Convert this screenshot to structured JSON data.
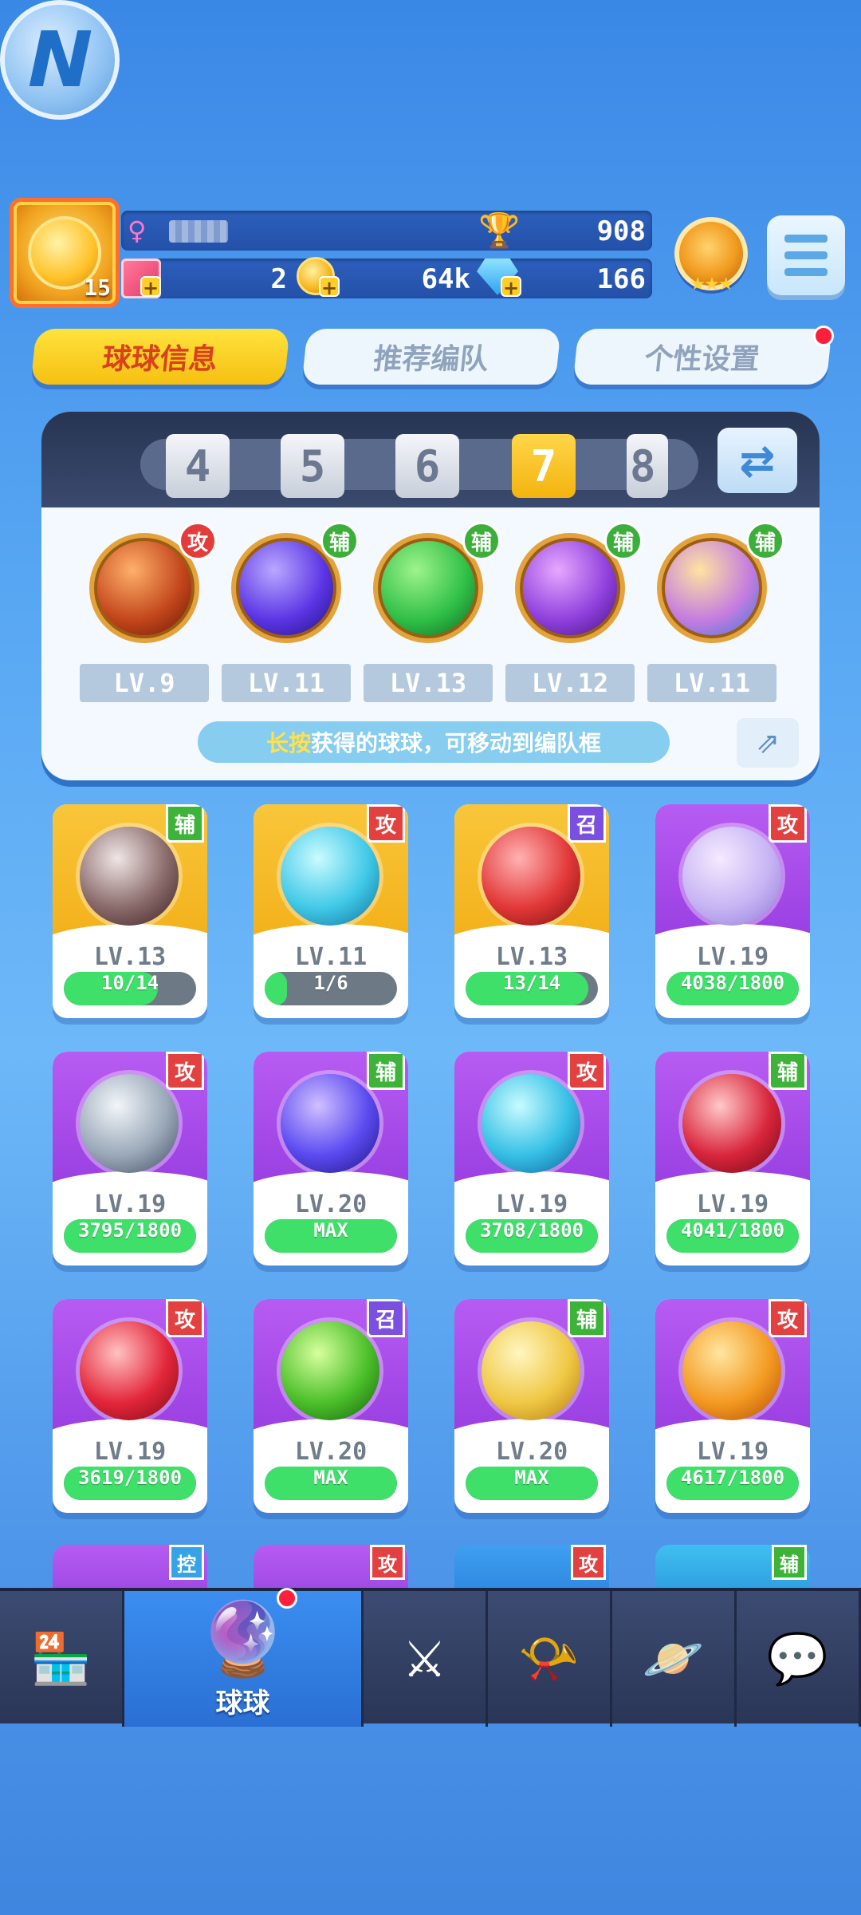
{
  "header": {
    "player_level": "15",
    "trophies": "908",
    "tickets": "2",
    "coins": "64k",
    "gems": "166",
    "rank_stars": "★★★",
    "gender_icon": "female-icon"
  },
  "tabs": [
    {
      "label": "球球信息",
      "active": true
    },
    {
      "label": "推荐编队",
      "active": false
    },
    {
      "label": "个性设置",
      "active": false,
      "notify": true
    }
  ],
  "team_selector": {
    "numbers": [
      "4",
      "5",
      "6",
      "7",
      "8"
    ],
    "selected": "7"
  },
  "team_balls": [
    {
      "tag": "攻",
      "type": "atk",
      "level": "LV.9",
      "icon": "infinity-ball-icon",
      "colors": [
        "#ffb06a",
        "#c2451b",
        "#5a1306"
      ]
    },
    {
      "tag": "辅",
      "type": "sup",
      "level": "LV.11",
      "icon": "lightning-ball-icon",
      "colors": [
        "#b9a8ff",
        "#5a34e4",
        "#1d0e6d"
      ]
    },
    {
      "tag": "辅",
      "type": "sup",
      "level": "LV.13",
      "icon": "star-arrow-ball-icon",
      "colors": [
        "#9ef48c",
        "#2fbf47",
        "#0f5a1e"
      ]
    },
    {
      "tag": "辅",
      "type": "sup",
      "level": "LV.12",
      "icon": "leaf-ball-icon",
      "colors": [
        "#e6a8ff",
        "#8f3fdc",
        "#3c0e70"
      ]
    },
    {
      "tag": "辅",
      "type": "sup",
      "level": "LV.11",
      "icon": "people-ball-icon",
      "colors": [
        "#ffe3a0",
        "#c47ce0",
        "#2d77d8"
      ]
    }
  ],
  "tip": {
    "highlight": "长按",
    "text": "获得的球球，可移动到编队框"
  },
  "cards": [
    {
      "tag": "辅",
      "type": "sup",
      "theme": "gold",
      "level": "LV.13",
      "progress": "10/14",
      "fill": 0.71,
      "icon": "skull-ball-icon",
      "colors": [
        "#f0e6e6",
        "#8a6a6a",
        "#3a1f1f"
      ]
    },
    {
      "tag": "攻",
      "type": "atk",
      "theme": "gold",
      "level": "LV.11",
      "progress": "1/6",
      "fill": 0.17,
      "icon": "trident-ball-icon",
      "colors": [
        "#c9fbff",
        "#41c9e8",
        "#0e6d9a"
      ]
    },
    {
      "tag": "召",
      "type": "sum",
      "theme": "gold",
      "level": "LV.13",
      "progress": "13/14",
      "fill": 0.93,
      "icon": "cannon-ball-icon",
      "colors": [
        "#ffb2b2",
        "#e23838",
        "#7a0e0e"
      ]
    },
    {
      "tag": "攻",
      "type": "atk",
      "theme": "purple",
      "level": "LV.19",
      "progress": "4038/1800",
      "fill": 1,
      "icon": "bubble-ball-icon",
      "colors": [
        "#f4eaff",
        "#c7b4f4",
        "#8c7ad6"
      ]
    },
    {
      "tag": "攻",
      "type": "atk",
      "theme": "purple",
      "level": "LV.19",
      "progress": "3795/1800",
      "fill": 1,
      "icon": "fan-ball-icon",
      "colors": [
        "#f2f6fa",
        "#9aa8b8",
        "#3d4c5e"
      ]
    },
    {
      "tag": "辅",
      "type": "sup",
      "theme": "purple",
      "level": "LV.20",
      "progress": "MAX",
      "fill": 1,
      "icon": "arrow-ball-icon",
      "colors": [
        "#d0c0ff",
        "#5b4bf0",
        "#1c1480"
      ]
    },
    {
      "tag": "攻",
      "type": "atk",
      "theme": "purple",
      "level": "LV.19",
      "progress": "3708/1800",
      "fill": 1,
      "icon": "whirl-ball-icon",
      "colors": [
        "#c8fbff",
        "#36c0e6",
        "#0c5f9a"
      ]
    },
    {
      "tag": "辅",
      "type": "sup",
      "theme": "purple",
      "level": "LV.19",
      "progress": "4041/1800",
      "fill": 1,
      "icon": "fang-ball-icon",
      "colors": [
        "#ffc9c9",
        "#d8263c",
        "#6e0616"
      ]
    },
    {
      "tag": "攻",
      "type": "atk",
      "theme": "purple",
      "level": "LV.19",
      "progress": "3619/1800",
      "fill": 1,
      "icon": "break-ball-icon",
      "colors": [
        "#ffc2c2",
        "#e3263a",
        "#7a0a16"
      ]
    },
    {
      "tag": "召",
      "type": "sum",
      "theme": "purple",
      "level": "LV.20",
      "progress": "MAX",
      "fill": 1,
      "icon": "radiation-ball-icon",
      "colors": [
        "#d7ff9e",
        "#4cc02a",
        "#15600e"
      ]
    },
    {
      "tag": "辅",
      "type": "sup",
      "theme": "purple",
      "level": "LV.20",
      "progress": "MAX",
      "fill": 1,
      "icon": "lion-ball-icon",
      "colors": [
        "#fff6c0",
        "#f0c845",
        "#b2780e"
      ]
    },
    {
      "tag": "攻",
      "type": "atk",
      "theme": "purple",
      "level": "LV.19",
      "progress": "4617/1800",
      "fill": 1,
      "icon": "sun-ball-icon",
      "colors": [
        "#ffe6a0",
        "#f39a22",
        "#b24a06"
      ]
    }
  ],
  "partial_tags": [
    {
      "tag": "控",
      "type": "ctl"
    },
    {
      "tag": "攻",
      "type": "atk"
    },
    {
      "tag": "攻",
      "type": "atk"
    },
    {
      "tag": "辅",
      "type": "sup"
    }
  ],
  "nav": [
    {
      "icon": "shop-icon",
      "glyph": "🏪",
      "label": ""
    },
    {
      "icon": "balls-icon",
      "glyph": "🔮",
      "label": "球球",
      "selected": true
    },
    {
      "icon": "battle-swords-icon",
      "glyph": "⚔",
      "label": ""
    },
    {
      "icon": "whistle-icon",
      "glyph": "📯",
      "label": ""
    },
    {
      "icon": "planet-icon",
      "glyph": "🪐",
      "label": ""
    },
    {
      "icon": "chat-heart-icon",
      "glyph": "💬",
      "label": ""
    }
  ]
}
